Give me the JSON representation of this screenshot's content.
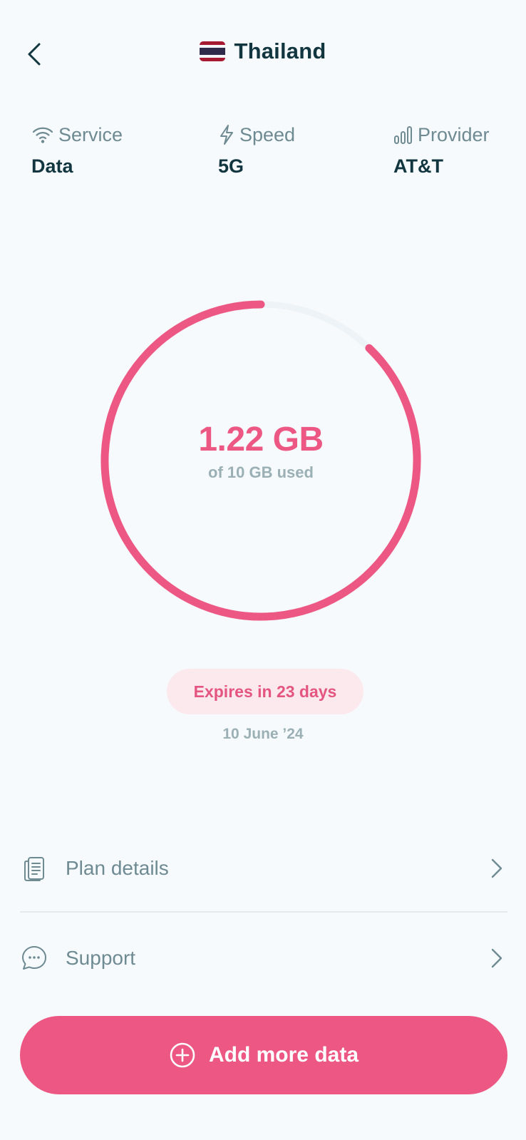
{
  "header": {
    "title": "Thailand",
    "back_icon": "chevron-left-icon",
    "flag_icon": "thailand-flag-icon"
  },
  "info": [
    {
      "label": "Service",
      "value": "Data",
      "icon": "wifi-icon"
    },
    {
      "label": "Speed",
      "value": "5G",
      "icon": "lightning-icon"
    },
    {
      "label": "Provider",
      "value": "AT&T",
      "icon": "signal-bars-icon"
    }
  ],
  "usage": {
    "used_label": "1.22 GB",
    "total_label": "of 10 GB used",
    "used_gb": 1.22,
    "total_gb": 10,
    "ring_fill_fraction": 0.878
  },
  "expiry": {
    "badge": "Expires in 23 days",
    "date": "10 June ’24"
  },
  "menu": {
    "plan_details": {
      "label": "Plan details",
      "icon": "document-icon"
    },
    "support": {
      "label": "Support",
      "icon": "chat-bubble-icon"
    }
  },
  "cta": {
    "label": "Add more data",
    "icon": "plus-circle-icon"
  },
  "colors": {
    "accent": "#EC5883",
    "ring_track": "#EDF3F6",
    "text_primary": "#123640",
    "text_secondary": "#6E8A92",
    "text_muted": "#9AB0B5",
    "badge_bg": "#FCE9EE",
    "background": "#F7FAFC"
  }
}
